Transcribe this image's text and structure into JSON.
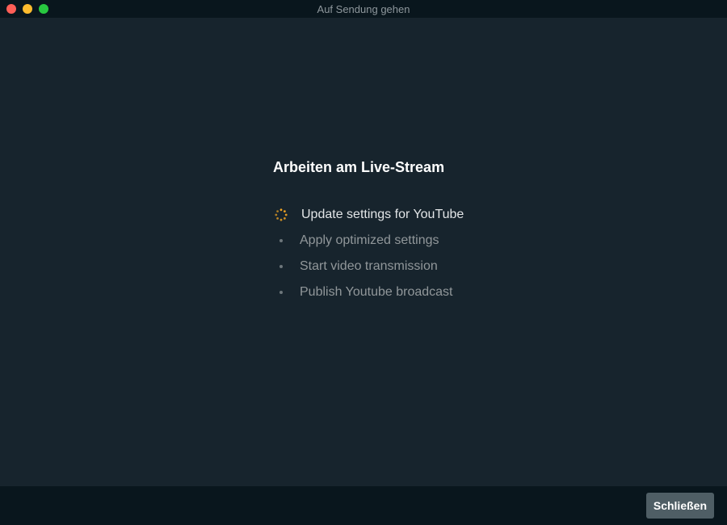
{
  "window": {
    "title": "Auf Sendung gehen"
  },
  "main": {
    "heading": "Arbeiten am Live-Stream",
    "steps": [
      {
        "label": "Update settings for YouTube",
        "status": "in-progress"
      },
      {
        "label": "Apply optimized settings",
        "status": "pending"
      },
      {
        "label": "Start video transmission",
        "status": "pending"
      },
      {
        "label": "Publish Youtube broadcast",
        "status": "pending"
      }
    ]
  },
  "footer": {
    "close_label": "Schließen"
  },
  "colors": {
    "background": "#17242D",
    "titlebar": "#09161D",
    "spinner": "#F5A623",
    "button": "#4F5E65"
  },
  "icons": {
    "in_progress": "loading-spinner-icon",
    "pending": "bullet-dot-icon"
  }
}
